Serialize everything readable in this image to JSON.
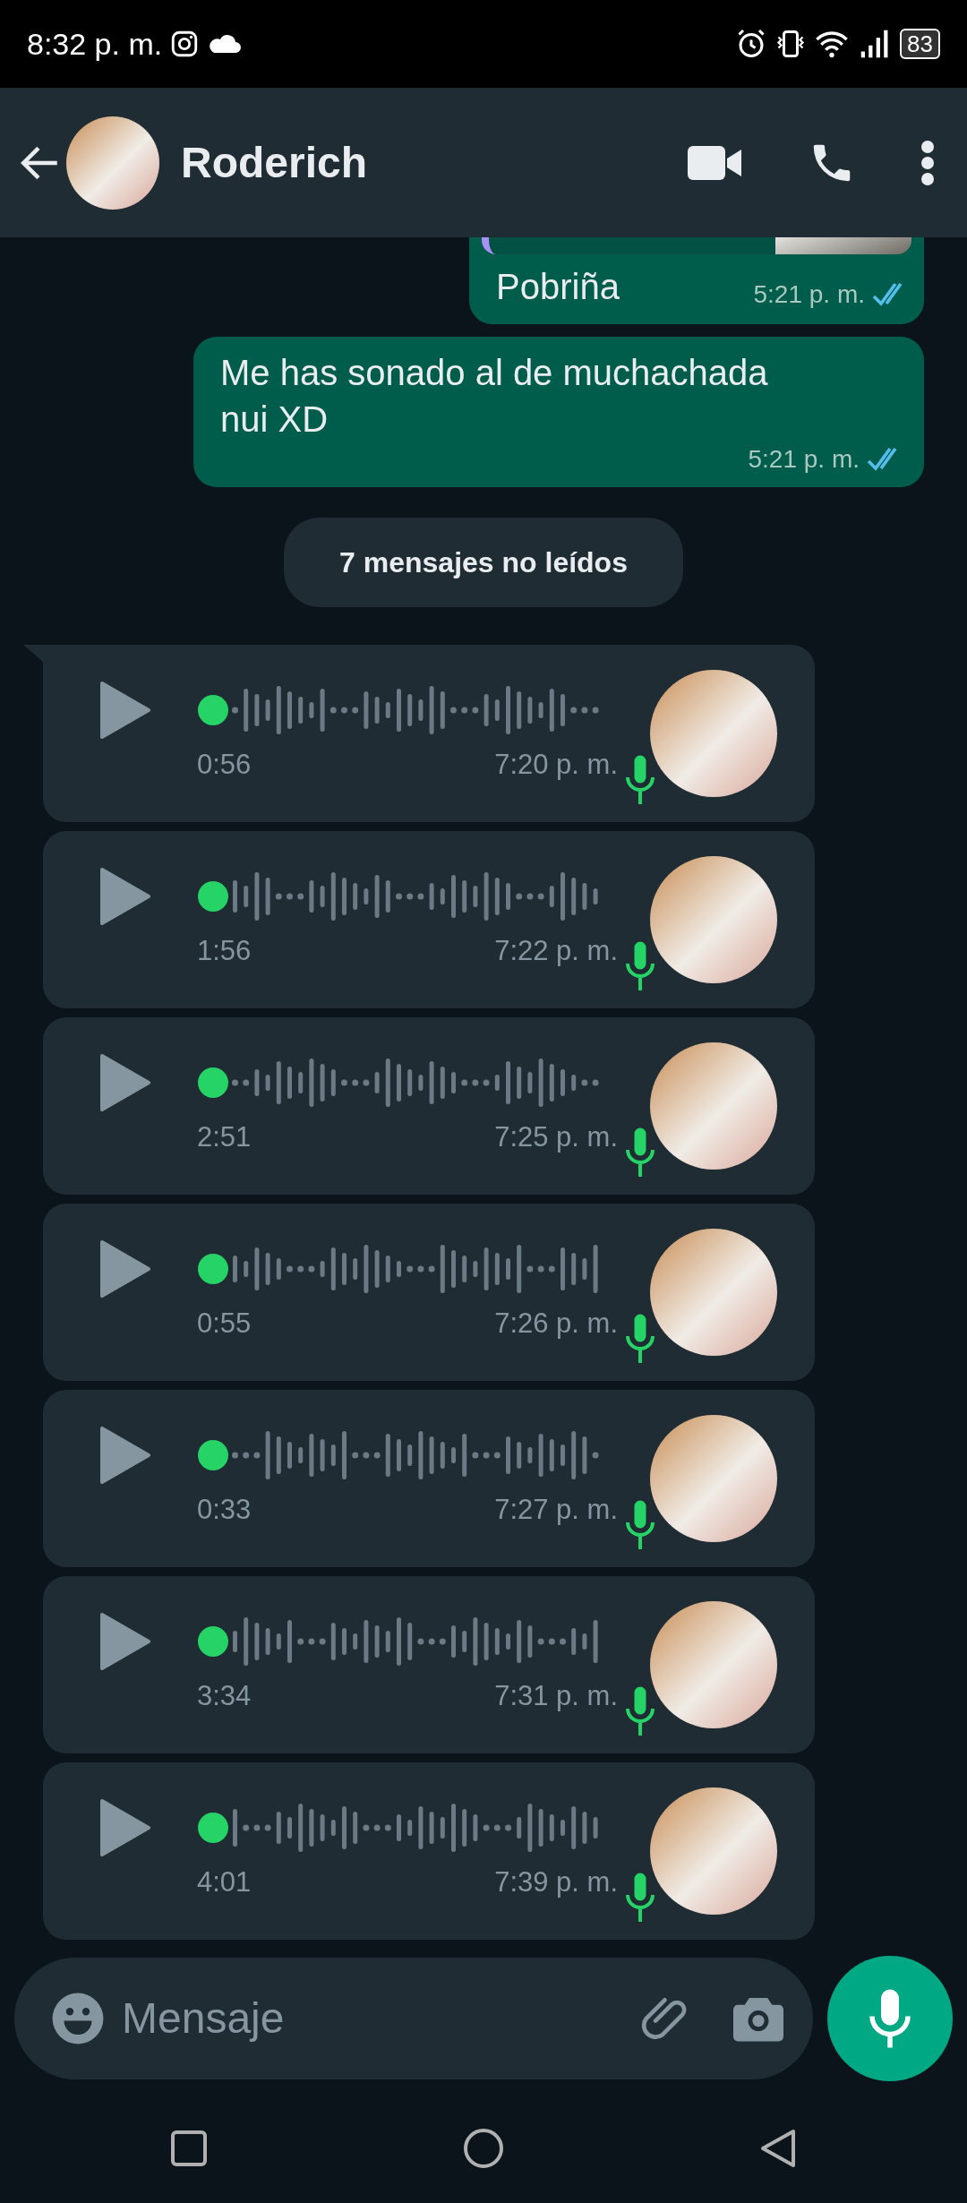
{
  "status_bar": {
    "time": "8:32 p. m.",
    "battery": "83"
  },
  "header": {
    "contact_name": "Roderich"
  },
  "messages": [
    {
      "kind": "video_reply",
      "text": "Pobriña",
      "time": "5:21 p. m.",
      "read": true
    },
    {
      "kind": "text",
      "text": "Me has sonado al de muchachada nui XD",
      "time": "5:21 p. m.",
      "read": true
    },
    {
      "kind": "unread_divider",
      "text": "7 mensajes no leídos"
    },
    {
      "kind": "voice",
      "duration": "0:56",
      "time": "7:20 p. m.",
      "tail": true
    },
    {
      "kind": "voice",
      "duration": "1:56",
      "time": "7:22 p. m.",
      "tail": false
    },
    {
      "kind": "voice",
      "duration": "2:51",
      "time": "7:25 p. m.",
      "tail": false
    },
    {
      "kind": "voice",
      "duration": "0:55",
      "time": "7:26 p. m.",
      "tail": false
    },
    {
      "kind": "voice",
      "duration": "0:33",
      "time": "7:27 p. m.",
      "tail": false
    },
    {
      "kind": "voice",
      "duration": "3:34",
      "time": "7:31 p. m.",
      "tail": false
    },
    {
      "kind": "voice",
      "duration": "4:01",
      "time": "7:39 p. m.",
      "tail": false
    }
  ],
  "composer": {
    "placeholder": "Mensaje"
  }
}
